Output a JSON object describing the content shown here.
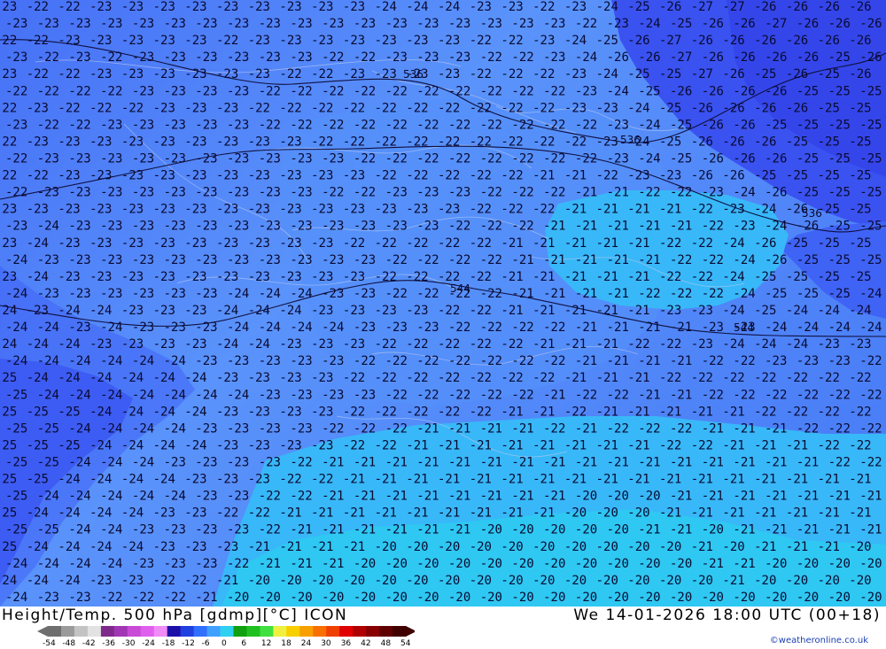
{
  "map": {
    "product_title": "Height/Temp. 500 hPa [gdmp][°C] ICON",
    "valid_time": "We 14-01-2026 18:00 UTC (00+18)",
    "credit": "©weatheronline.co.uk",
    "colorbar": {
      "ticks": [
        "-54",
        "-48",
        "-42",
        "-36",
        "-30",
        "-24",
        "-18",
        "-12",
        "-6",
        "0",
        "6",
        "12",
        "18",
        "24",
        "30",
        "36",
        "42",
        "48",
        "54"
      ],
      "colors": [
        "#6e6e6e",
        "#9a9a9a",
        "#c3c3c3",
        "#e2e2e2",
        "#7e2a8c",
        "#a136b4",
        "#c84ad6",
        "#e060ee",
        "#f08cf6",
        "#1c0fa8",
        "#2040e0",
        "#3070ff",
        "#40a0ff",
        "#30d0f0",
        "#10a010",
        "#20c020",
        "#40e040",
        "#f0f040",
        "#f8d000",
        "#f8a000",
        "#f87000",
        "#f04000",
        "#e00000",
        "#b00000",
        "#880000",
        "#600000",
        "#400000"
      ]
    },
    "fill_colors": {
      "t_minus_25": "#3a52f0",
      "t_minus_24": "#3f63f5",
      "t_minus_23": "#4a7df8",
      "t_minus_22": "#5590fb",
      "t_minus_21": "#38b8f8",
      "t_minus_20": "#2ec8f2"
    },
    "height_labels": [
      "536",
      "536",
      "536",
      "544",
      "544"
    ],
    "temp_rows": [
      "23 22 22 23 23 23 23 23 23 23 23 23 24 24 24 23 23 22 23 24 25 26 27 27 26 26 26 26",
      "23 23 23 23 23 23 23 23 23 23 23 23 23 23 23 23 23 23 22 23 24 25 26 26 27 26 26 26",
      "22 22 23 23 23 23 23 22 23 23 23 23 23 23 23 22 22 23 24 25 26 27 26 26 26 26 26 26",
      "23 22 23 22 23 23 23 23 23 23 22 22 23 23 23 22 22 23 24 26 26 27 26 26 26 26 25 26",
      "23 22 22 23 23 23 23 23 23 22 22 23 23 23 23 22 22 22 23 24 25 25 27 26 25 26 25 26",
      "22 22 22 22 23 23 23 23 22 22 22 22 22 22 22 22 22 22 23 24 25 26 26 26 26 25 25 25",
      "22 23 22 22 22 23 23 23 22 22 22 22 22 22 22 22 22 22 23 23 24 25 26 26 26 26 25 25",
      "23 22 22 23 23 23 23 23 22 22 22 22 22 22 22 22 22 22 22 23 24 25 26 26 25 25 25 25",
      "22 23 23 23 23 23 23 23 23 23 22 22 22 22 22 22 22 22 22 23 24 25 26 26 26 25 25 25",
      "22 23 23 23 23 23 23 23 23 23 23 22 22 22 22 22 22 22 22 23 24 25 26 26 26 25 25 25",
      "22 22 23 23 23 23 23 23 23 23 23 23 22 22 22 22 22 21 21 22 23 23 26 26 25 25 25 25",
      "22 23 23 23 23 23 23 23 23 23 22 22 23 23 23 22 22 22 21 21 22 22 23 24 26 25 25 25",
      "23 23 23 23 23 23 23 23 23 23 23 23 23 23 23 22 22 22 21 21 21 21 22 23 24 26 25 25",
      "23 24 23 23 23 23 23 23 23 23 23 23 23 23 22 22 22 21 21 21 21 21 22 23 24 26 25 25",
      "23 24 23 23 23 23 23 23 23 23 23 22 22 22 22 22 21 21 21 21 21 22 22 24 26 25 25 25",
      "24 23 23 23 23 23 23 23 23 23 23 23 22 22 22 22 21 21 21 21 21 22 22 24 26 25 25 25",
      "23 24 23 23 23 23 23 23 23 23 23 23 22 22 22 22 21 21 21 21 21 22 22 24 25 25 25 25",
      "24 23 23 23 23 23 23 24 24 24 23 23 22 22 22 22 21 21 21 21 22 22 22 24 25 25 25 24",
      "24 23 24 24 23 23 23 24 24 24 23 23 23 23 22 22 21 21 21 21 21 23 23 24 25 24 24 24",
      "24 24 23 24 23 23 23 24 24 24 24 23 23 23 22 22 22 22 21 21 21 21 23 23 24 24 24 24",
      "24 24 24 23 23 23 23 24 24 23 23 23 22 22 22 22 22 21 21 21 22 22 23 24 24 24 23 23",
      "24 24 24 24 24 24 23 23 23 23 23 22 22 22 22 22 22 22 21 21 21 21 22 22 23 23 23 22",
      "25 24 24 24 24 24 24 23 23 23 23 22 22 22 22 22 22 22 21 21 21 22 22 22 22 22 22 22",
      "25 24 24 24 24 24 24 24 23 23 23 23 22 22 22 22 22 21 22 22 21 21 22 22 22 22 22 22",
      "25 25 25 24 24 24 24 23 23 23 23 22 22 22 22 22 21 21 22 21 21 21 21 21 22 22 22 22",
      "25 25 24 24 24 24 23 23 23 23 22 22 22 21 21 21 21 22 21 22 22 22 21 21 21 22 22 22",
      "25 25 25 24 24 24 24 23 23 23 23 22 22 21 21 21 21 21 21 21 21 22 22 21 21 21 22 22",
      "25 25 24 24 24 23 23 23 23 22 21 21 21 21 21 21 21 21 21 21 21 21 21 21 21 21 22 22",
      "25 25 24 24 24 24 23 23 23 22 22 21 21 21 21 21 21 21 21 21 21 21 21 21 21 21 21 21",
      "25 24 24 24 24 24 23 23 22 22 21 21 21 21 21 21 21 21 20 20 20 21 21 21 21 21 21 21",
      "25 24 24 24 24 23 23 22 22 21 21 21 21 21 21 21 21 21 20 20 20 21 21 21 21 21 21 21",
      "25 25 24 24 23 23 23 23 22 21 21 21 21 21 21 20 20 20 20 20 21 21 20 21 21 21 21 21",
      "25 24 24 24 24 23 23 23 21 21 21 21 20 20 20 20 20 20 20 20 20 20 21 20 21 21 21 20",
      "24 24 24 24 23 23 23 22 21 21 21 20 20 20 20 20 20 20 20 20 20 20 21 21 20 20 20 20",
      "24 24 24 23 23 22 22 21 20 20 20 20 20 20 20 20 20 20 20 20 20 20 20 21 20 20 20 20",
      "24 23 23 22 22 22 21 20 20 20 20 20 20 20 20 20 20 20 20 20 20 20 20 20 20 20 20 20"
    ]
  }
}
